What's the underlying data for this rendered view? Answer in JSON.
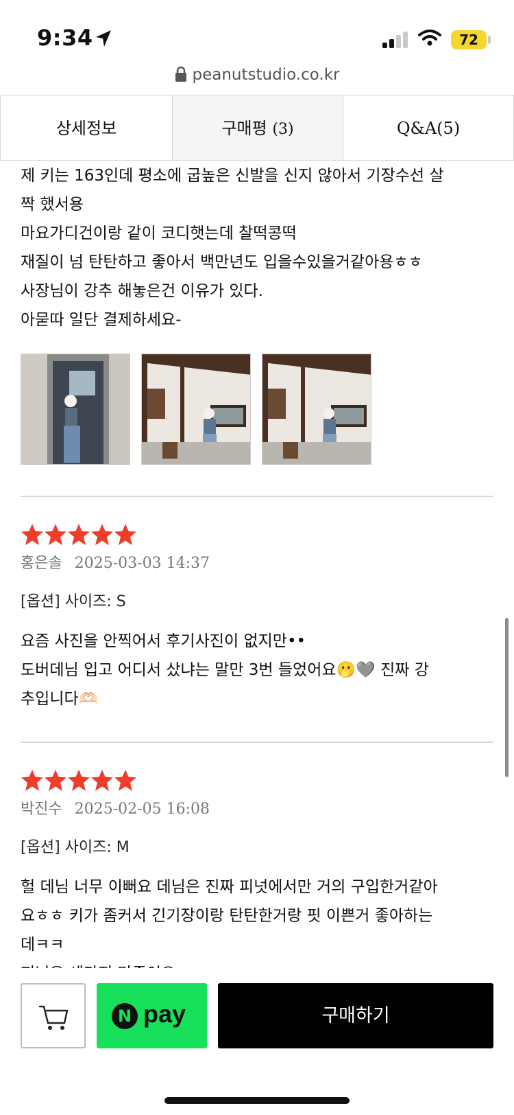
{
  "status_bar": {
    "time": "9:34",
    "battery": "72"
  },
  "browser": {
    "url": "peanutstudio.co.kr"
  },
  "tabs": [
    {
      "label": "상세정보",
      "count": ""
    },
    {
      "label": "구매평",
      "count": "(3)"
    },
    {
      "label": "Q&A(5)",
      "count": ""
    }
  ],
  "review1": {
    "lines": [
      "제 키는 163인데 평소에 굽높은 신발을 신지 않아서 기장수선 살",
      "짝 했서용",
      "마요가디건이랑 같이 코디햇는데 찰떡콩떡",
      "재질이 넘 탄탄하고 좋아서 백만년도 입을수있을거같아용ㅎㅎ",
      "사장님이 강추 해놓은건 이유가 있다.",
      "아묻따 일단 결제하세요-"
    ]
  },
  "review2": {
    "rating": 5,
    "author": "홍은솔",
    "date": "2025-03-03 14:37",
    "option": "[옵션] 사이즈: S",
    "lines": [
      "요즘 사진을 안찍어서 후기사진이 없지만••",
      "도버데님 입고 어디서 샀냐는 말만 3번 들었어요🫢🩶 진짜 강",
      "추입니다🫶🏻"
    ]
  },
  "review3": {
    "rating": 5,
    "author": "박진수",
    "date": "2025-02-05 16:08",
    "option": "[옵션] 사이즈: M",
    "lines": [
      "헐 데님 너무 이뻐요 데님은 진짜 피넛에서만 거의 구입한거같아",
      "요ㅎㅎ 키가 좀커서 긴기장이랑 탄탄한거랑 핏 이쁜거 좋아하는",
      "데ㅋㅋ",
      "피넛은 세가지 만족이요"
    ]
  },
  "bottom_bar": {
    "npay_n": "N",
    "npay_label": "pay",
    "buy_label": "구매하기"
  },
  "colors": {
    "star": "#f03c2a",
    "npay": "#18e05a",
    "buy_bg": "#000000",
    "battery": "#f7d52f"
  },
  "icons": [
    "location-arrow-icon",
    "signal-icon",
    "wifi-icon",
    "lock-icon",
    "star-icon",
    "cart-icon"
  ]
}
